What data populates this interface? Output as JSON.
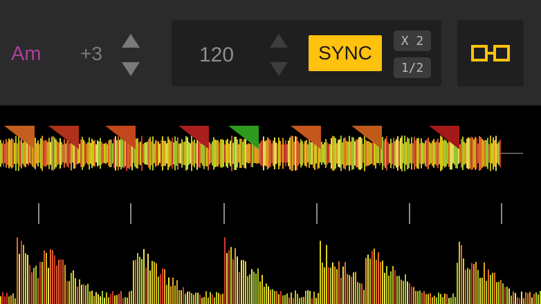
{
  "deck": {
    "key": "Am",
    "pitch": "+3",
    "bpm": "120",
    "sync_label": "SYNC",
    "double_label": "X 2",
    "half_label": "1/2"
  },
  "colors": {
    "key": "#a9409a",
    "sync_active": "#ffc20e",
    "link_icon": "#ffc20e",
    "toolbar_bg": "#2b2b2b",
    "panel_bg": "#1f1f1f",
    "waveform_bg": "#000000"
  },
  "icons": {
    "pitch_up": "triangle-up",
    "pitch_down": "triangle-down",
    "bpm_up": "triangle-up",
    "bpm_down": "triangle-down",
    "link": "chain-link"
  }
}
